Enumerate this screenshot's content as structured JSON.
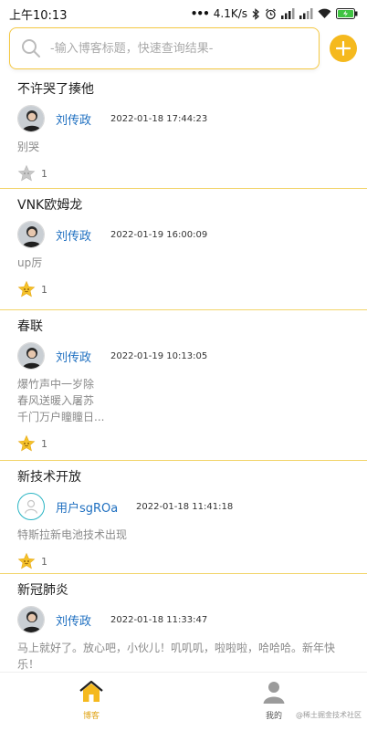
{
  "status_bar": {
    "time": "上午10:13",
    "network_speed": "4.1K/s",
    "battery_color": "#3fc341"
  },
  "search": {
    "placeholder": "-输入博客标题，快速查询结果-"
  },
  "colors": {
    "accent": "#f5b91e",
    "author_link": "#1e6fc0",
    "divider": "#f2d46a"
  },
  "posts": [
    {
      "title": "不许哭了揍他",
      "author": "刘传政",
      "time": "2022-01-18 17:44:23",
      "excerpt": [
        "别哭"
      ],
      "likes": "1",
      "liked": false
    },
    {
      "title": "VNK欧姆龙",
      "author": "刘传政",
      "time": "2022-01-19 16:00:09",
      "excerpt": [
        "up厉"
      ],
      "likes": "1",
      "liked": true
    },
    {
      "title": "春联",
      "author": "刘传政",
      "time": "2022-01-19 10:13:05",
      "excerpt": [
        "爆竹声中一岁除",
        "春风送暖入屠苏",
        "千门万户瞳瞳日..."
      ],
      "likes": "1",
      "liked": true
    },
    {
      "title": "新技术开放",
      "author": "用户sgROa",
      "time": "2022-01-18 11:41:18",
      "excerpt": [
        "特斯拉新电池技术出现"
      ],
      "likes": "1",
      "liked": true
    },
    {
      "title": "新冠肺炎",
      "author": "刘传政",
      "time": "2022-01-18 11:33:47",
      "excerpt": [
        "马上就好了。放心吧，小伙儿！叽叽叽，啦啦啦，哈哈哈。新年快",
        "乐！"
      ],
      "likes": "1",
      "liked": true
    }
  ],
  "nav": {
    "blog_label": "博客",
    "mine_label": "我的"
  },
  "watermark": "@稀土掘金技术社区"
}
